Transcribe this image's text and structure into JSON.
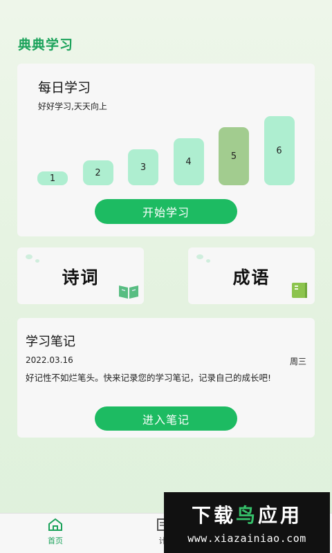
{
  "app": {
    "title": "典典学习"
  },
  "daily": {
    "title": "每日学习",
    "subtitle": "好好学习,天天向上",
    "levels": [
      {
        "label": "1",
        "level": 1,
        "active": false
      },
      {
        "label": "2",
        "level": 2,
        "active": false
      },
      {
        "label": "3",
        "level": 3,
        "active": false
      },
      {
        "label": "4",
        "level": 4,
        "active": false
      },
      {
        "label": "5",
        "level": 5,
        "active": true
      },
      {
        "label": "6",
        "level": 6,
        "active": false
      }
    ],
    "start_label": "开始学习"
  },
  "modules": {
    "poem": {
      "label": "诗词",
      "icon": "open-book-icon"
    },
    "idiom": {
      "label": "成语",
      "icon": "closed-book-icon"
    }
  },
  "notes": {
    "title": "学习笔记",
    "date": "2022.03.16",
    "weekday": "周三",
    "text": "好记性不如烂笔头。快来记录您的学习笔记，记录自己的成长吧!",
    "button_label": "进入笔记"
  },
  "tabbar": {
    "home_label": "首页",
    "notes_label": "计",
    "home_icon": "home-icon",
    "notes_icon": "notebook-icon"
  },
  "watermark": {
    "text_part1": "下载",
    "text_part2": "鸟",
    "text_part3": "应用",
    "url": "www.xiazainiao.com"
  },
  "colors": {
    "accent": "#1dbb62",
    "title_green": "#1aa25a",
    "bar": "#aeeed0",
    "bar_active": "#a2cc8f"
  }
}
